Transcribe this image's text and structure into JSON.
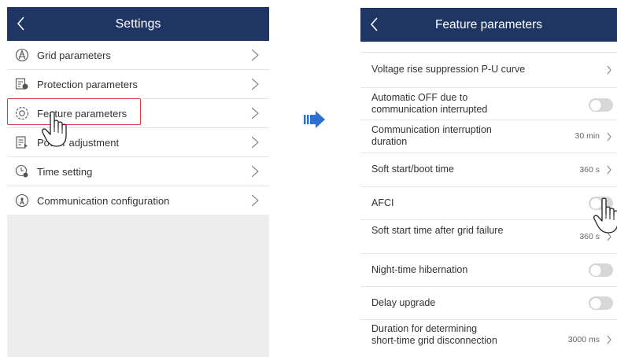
{
  "settings_screen": {
    "title": "Settings",
    "items": [
      {
        "label": "Grid parameters",
        "icon": "grid-icon"
      },
      {
        "label": "Protection parameters",
        "icon": "protection-icon"
      },
      {
        "label": "Feature parameters",
        "icon": "feature-icon"
      },
      {
        "label": "Power adjustment",
        "icon": "power-adjustment-icon"
      },
      {
        "label": "Time setting",
        "icon": "time-icon"
      },
      {
        "label": "Communication configuration",
        "icon": "communication-icon"
      }
    ],
    "highlighted_item": "Feature parameters"
  },
  "feature_screen": {
    "title": "Feature parameters",
    "rows": [
      {
        "label": "Voltage rise suppression P-U curve",
        "value": "",
        "control": "chevron"
      },
      {
        "label": "Automatic OFF due to communication interrupted",
        "value": "",
        "control": "toggle",
        "state": "off"
      },
      {
        "label": "Communication interruption duration",
        "value": "30 min",
        "control": "chevron"
      },
      {
        "label": "Soft start/boot time",
        "value": "360 s",
        "control": "chevron"
      },
      {
        "label": "AFCI",
        "value": "",
        "control": "toggle",
        "state": "off"
      },
      {
        "label": "Soft start time after grid failure",
        "value": "360 s",
        "control": "chevron"
      },
      {
        "label": "Night-time hibernation",
        "value": "",
        "control": "toggle",
        "state": "off"
      },
      {
        "label": "Delay upgrade",
        "value": "",
        "control": "toggle",
        "state": "off"
      },
      {
        "label": "Duration for determining short-time grid disconnection",
        "value": "3000 ms",
        "control": "chevron"
      }
    ]
  },
  "colors": {
    "header_bg": "#1f3564",
    "highlight_border": "#e1343c",
    "arrow": "#2f6fd0",
    "toggle_off": "#d7d7d7"
  }
}
